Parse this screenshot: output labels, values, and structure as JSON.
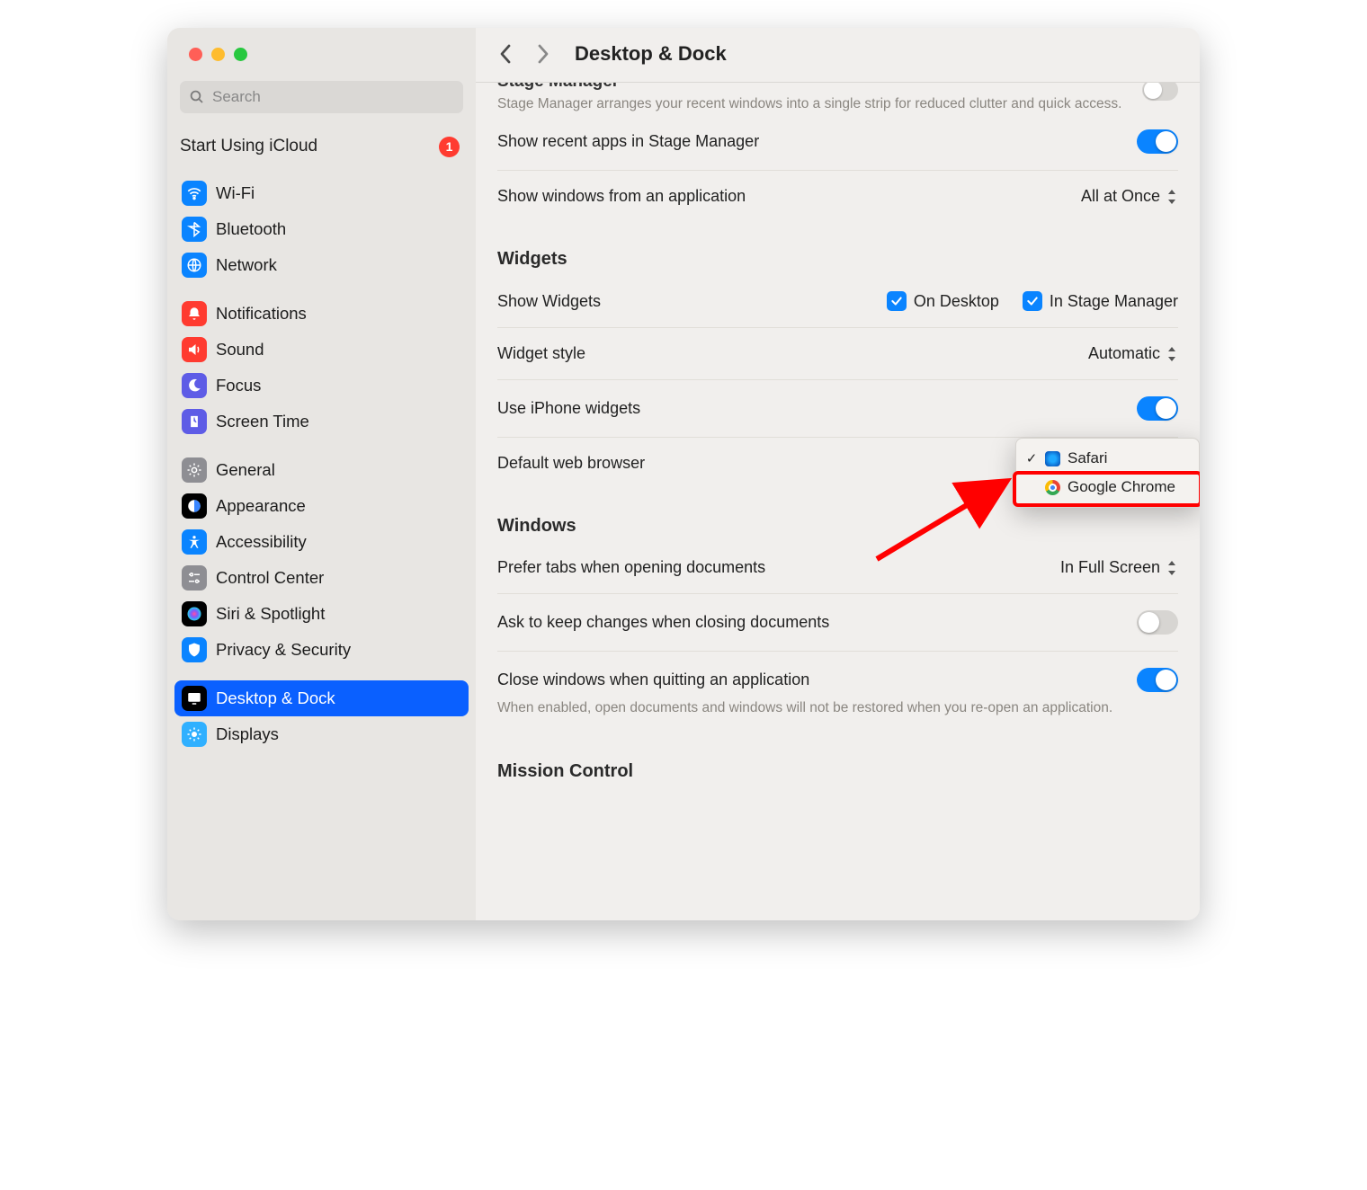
{
  "window": {
    "title": "Desktop & Dock"
  },
  "search": {
    "placeholder": "Search"
  },
  "icloud": {
    "label": "Start Using iCloud",
    "badge": "1"
  },
  "sidebar": {
    "items": [
      {
        "label": "Wi-Fi",
        "icon": "wifi-icon",
        "color": "#0a84ff"
      },
      {
        "label": "Bluetooth",
        "icon": "bluetooth-icon",
        "color": "#0a84ff"
      },
      {
        "label": "Network",
        "icon": "network-icon",
        "color": "#0a84ff"
      },
      {
        "label": "Notifications",
        "icon": "notifications-icon",
        "color": "#ff3b30"
      },
      {
        "label": "Sound",
        "icon": "sound-icon",
        "color": "#ff3b30"
      },
      {
        "label": "Focus",
        "icon": "focus-icon",
        "color": "#5e5ce6"
      },
      {
        "label": "Screen Time",
        "icon": "screentime-icon",
        "color": "#5e5ce6"
      },
      {
        "label": "General",
        "icon": "general-icon",
        "color": "#8e8e93"
      },
      {
        "label": "Appearance",
        "icon": "appearance-icon",
        "color": "#000000"
      },
      {
        "label": "Accessibility",
        "icon": "accessibility-icon",
        "color": "#0a84ff"
      },
      {
        "label": "Control Center",
        "icon": "controlcenter-icon",
        "color": "#8e8e93"
      },
      {
        "label": "Siri & Spotlight",
        "icon": "siri-icon",
        "color": "#000000"
      },
      {
        "label": "Privacy & Security",
        "icon": "privacy-icon",
        "color": "#0a84ff"
      },
      {
        "label": "Desktop & Dock",
        "icon": "desktop-icon",
        "color": "#000000",
        "selected": true
      },
      {
        "label": "Displays",
        "icon": "displays-icon",
        "color": "#30b0ff"
      }
    ],
    "gaps_after": [
      2,
      6,
      12
    ]
  },
  "main": {
    "stage_manager": {
      "title": "Stage Manager",
      "desc": "Stage Manager arranges your recent windows into a single strip for reduced clutter and quick access.",
      "show_recent_label": "Show recent apps in Stage Manager",
      "show_recent_on": true,
      "show_windows_label": "Show windows from an application",
      "show_windows_value": "All at Once"
    },
    "widgets": {
      "title": "Widgets",
      "show_label": "Show Widgets",
      "on_desktop": "On Desktop",
      "in_stage": "In Stage Manager",
      "style_label": "Widget style",
      "style_value": "Automatic",
      "iphone_label": "Use iPhone widgets",
      "iphone_on": true
    },
    "default_browser": {
      "label": "Default web browser",
      "options": [
        {
          "name": "Safari",
          "checked": true
        },
        {
          "name": "Google Chrome",
          "checked": false,
          "highlighted": true
        }
      ]
    },
    "windows": {
      "title": "Windows",
      "tabs_label": "Prefer tabs when opening documents",
      "tabs_value": "In Full Screen",
      "ask_label": "Ask to keep changes when closing documents",
      "ask_on": false,
      "close_label": "Close windows when quitting an application",
      "close_desc": "When enabled, open documents and windows will not be restored when you re-open an application.",
      "close_on": true
    },
    "mission": {
      "title": "Mission Control"
    }
  }
}
